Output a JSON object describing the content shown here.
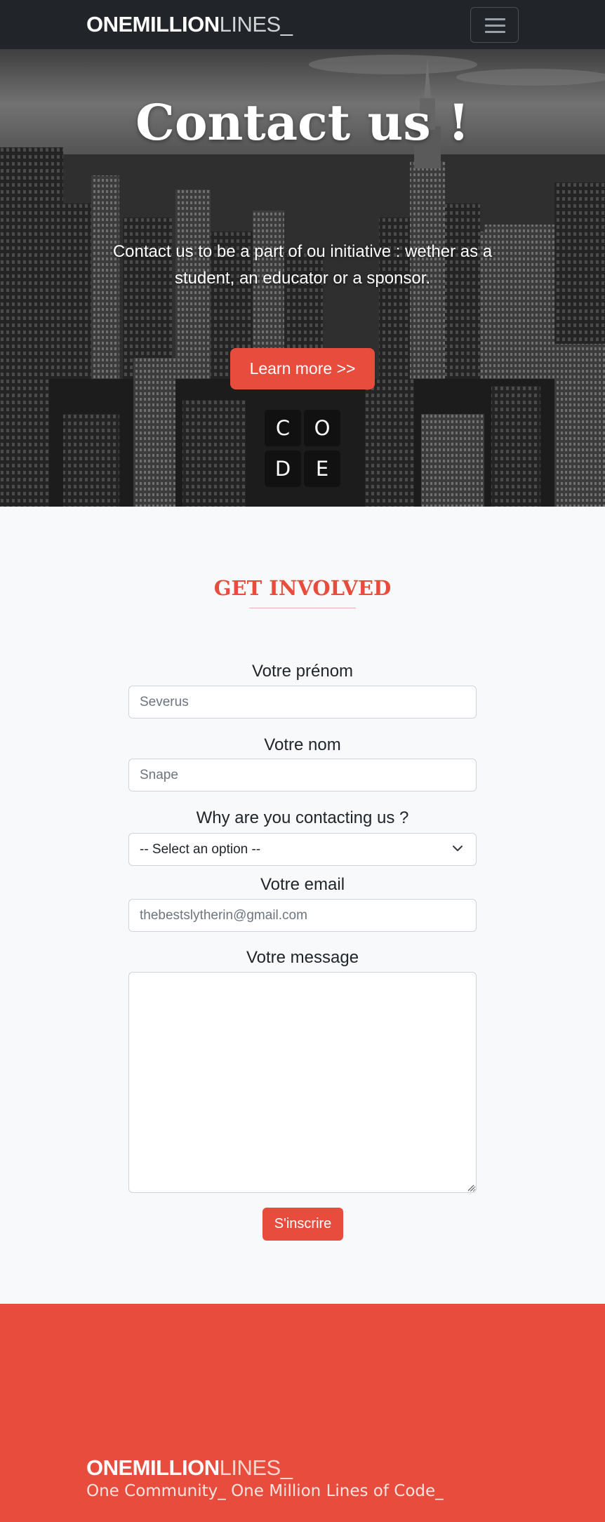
{
  "navbar": {
    "brand_bold": "ONEMILLION",
    "brand_light": "LINES_",
    "menu_icon": "hamburger-menu-icon"
  },
  "hero": {
    "title": "Contact us !",
    "text": "Contact us to be a part of ou initiative : wether as a student, an educator or a sponsor.",
    "button_label": "Learn more >>",
    "code_tiles": [
      "C",
      "O",
      "D",
      "E"
    ]
  },
  "form": {
    "section_title": "GET INVOLVED",
    "firstname": {
      "label": "Votre prénom",
      "placeholder": "Severus"
    },
    "lastname": {
      "label": "Votre nom",
      "placeholder": "Snape"
    },
    "reason": {
      "label": "Why are you contacting us ?",
      "selected": "-- Select an option --",
      "icon": "chevron-down-icon"
    },
    "email": {
      "label": "Votre email",
      "placeholder": "thebestslytherin@gmail.com"
    },
    "message": {
      "label": "Votre message",
      "value": ""
    },
    "submit_label": "S'inscrire"
  },
  "footer": {
    "brand_bold": "ONEMILLION",
    "brand_light": "LINES_",
    "tagline": "One Community_ One Million Lines of Code_"
  },
  "colors": {
    "accent": "#e74c3c",
    "navbar": "#212529",
    "page_background": "#f8f9fa"
  }
}
